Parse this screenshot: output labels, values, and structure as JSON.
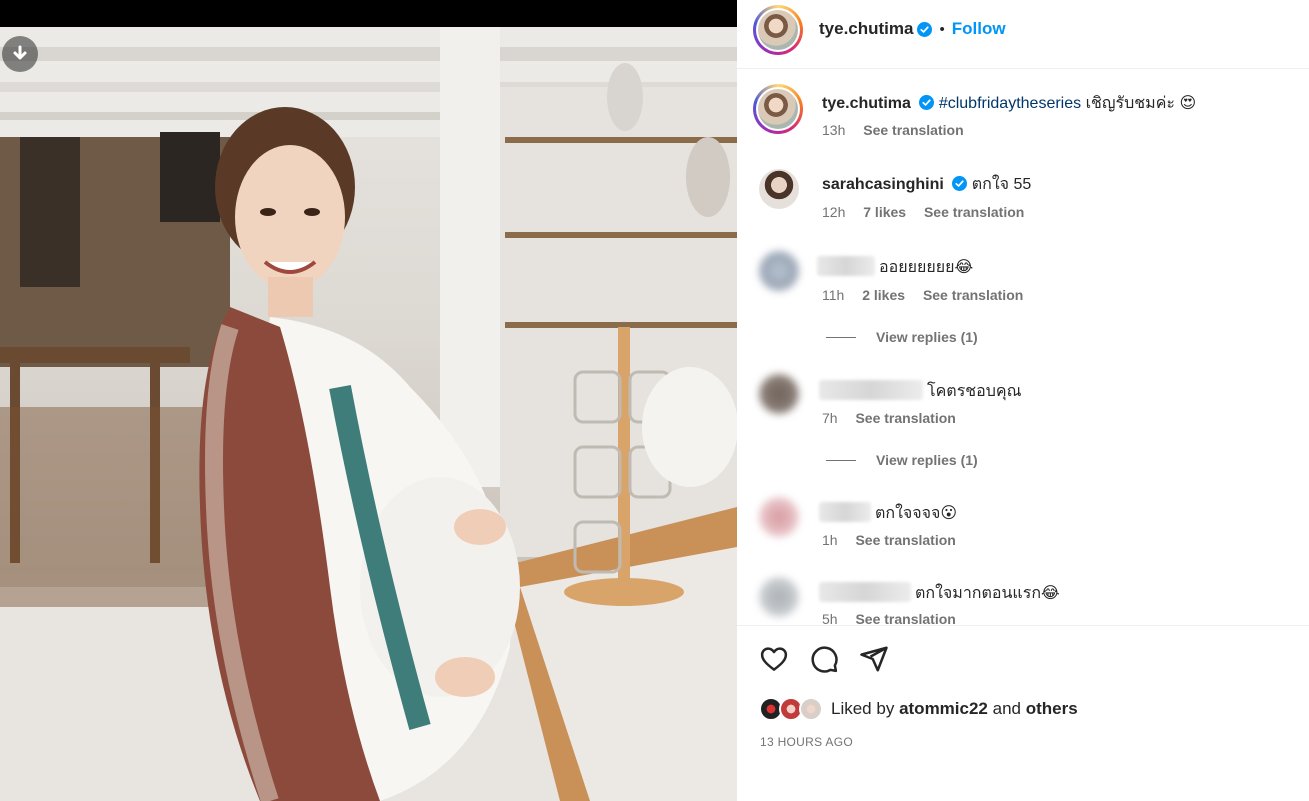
{
  "post": {
    "username": "tye.chutima",
    "follow_label": "Follow",
    "separator": "•",
    "caption": {
      "username": "tye.chutima",
      "hashtag": "#clubfridaytheseries",
      "text": "เชิญรับชมค่ะ",
      "emoji": "😍",
      "time": "13h",
      "see_translation": "See translation"
    },
    "comments": [
      {
        "username": "sarahcasinghini",
        "text": "ตกใจ 55",
        "time": "12h",
        "likes": "7 likes",
        "see_translation": "See translation"
      },
      {
        "username": "",
        "text": "ออยยยยยย😂",
        "time": "11h",
        "likes": "2 likes",
        "see_translation": "See translation",
        "view_replies": "View replies (1)"
      },
      {
        "username": "",
        "text": "โคตรชอบคุณ",
        "time": "7h",
        "see_translation": "See translation",
        "view_replies": "View replies (1)"
      },
      {
        "username": "",
        "text": "ตกใจจจจ😮",
        "time": "1h",
        "see_translation": "See translation"
      },
      {
        "username": "",
        "text": "ตกใจมากตอนแรก😂",
        "time": "5h",
        "see_translation": "See translation"
      }
    ],
    "liked_by": {
      "prefix": "Liked by",
      "user": "atommic22",
      "and": "and",
      "others": "others"
    },
    "timestamp": "13 HOURS AGO"
  },
  "colors": {
    "accent": "#0095f6",
    "verified": "#0095f6",
    "muted": "#737373",
    "text": "#262626",
    "hashtag": "#00376b"
  },
  "icons": [
    "download-icon",
    "verified-icon",
    "heart-icon",
    "comment-icon",
    "share-icon"
  ]
}
